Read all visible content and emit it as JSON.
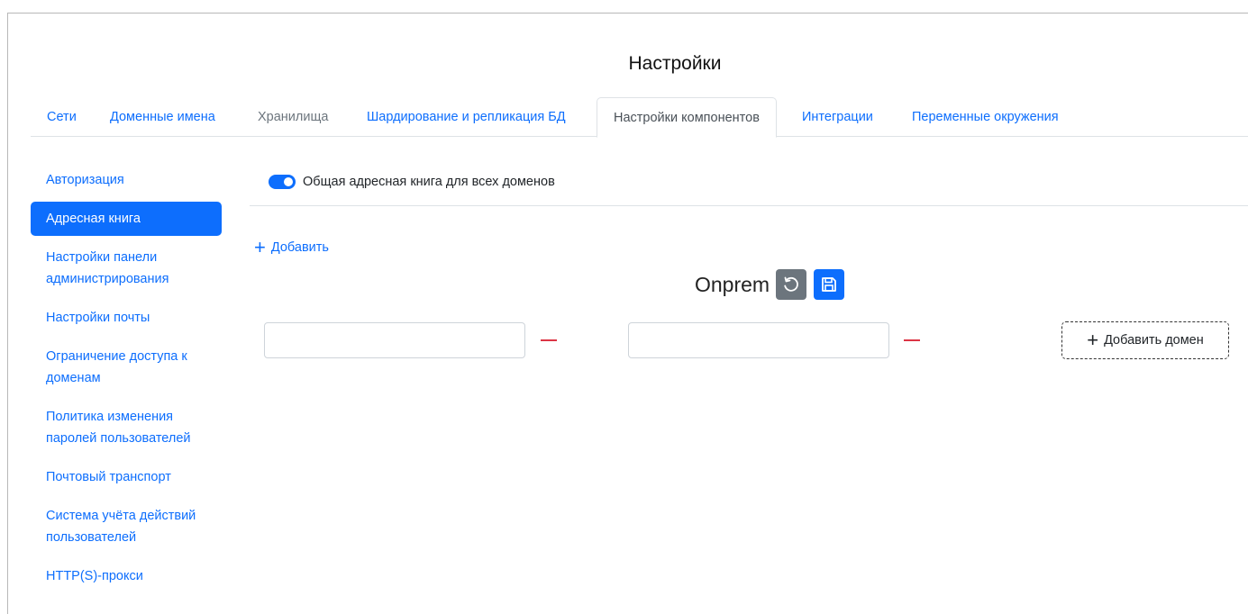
{
  "page": {
    "title": "Настройки"
  },
  "tabs": [
    {
      "label": "Сети"
    },
    {
      "label": "Доменные имена"
    },
    {
      "label": "Хранилища"
    },
    {
      "label": "Шардирование и репликация БД"
    },
    {
      "label": "Настройки компонентов"
    },
    {
      "label": "Интеграции"
    },
    {
      "label": "Переменные окружения"
    }
  ],
  "sidebar": {
    "items": [
      {
        "label": "Авторизация"
      },
      {
        "label": "Адресная книга"
      },
      {
        "label": "Настройки панели администрирования"
      },
      {
        "label": "Настройки почты"
      },
      {
        "label": "Ограничение доступа к доменам"
      },
      {
        "label": "Политика изменения паролей пользователей"
      },
      {
        "label": "Почтовый транспорт"
      },
      {
        "label": "Система учёта действий пользователей"
      },
      {
        "label": "HTTP(S)-прокси"
      }
    ]
  },
  "content": {
    "toggle_label": "Общая адресная книга для всех доменов",
    "add_label": "Добавить",
    "section_name": "Onprem",
    "domain_inputs": [
      {
        "value": ""
      },
      {
        "value": ""
      }
    ],
    "add_domain_label": "Добавить домен"
  },
  "colors": {
    "accent": "#0d6efd",
    "secondary": "#6c757d",
    "danger": "#dc3545"
  }
}
